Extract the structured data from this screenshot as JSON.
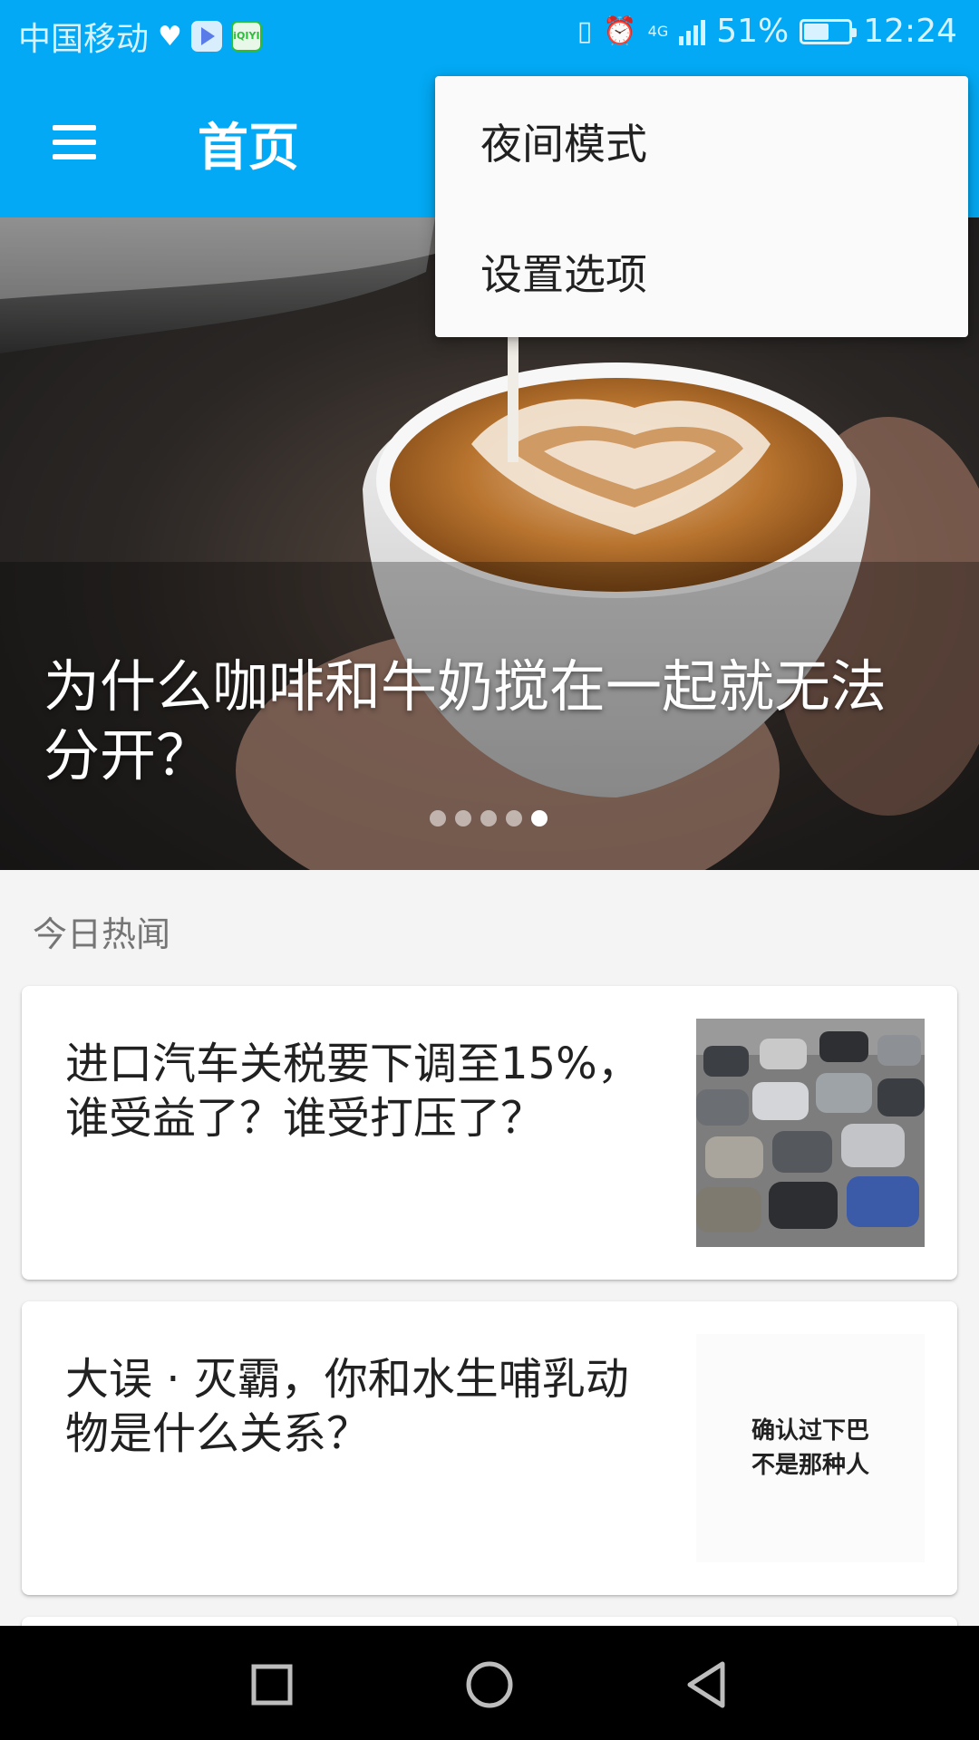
{
  "status_bar": {
    "carrier": "中国移动",
    "network": "4G",
    "battery": "51%",
    "time": "12:24",
    "background_color": "#03a9f4",
    "icons": [
      "heart-icon",
      "video-app-icon",
      "iqiyi-icon",
      "vibrate-icon",
      "alarm-icon",
      "signal-icon",
      "battery-icon"
    ]
  },
  "toolbar": {
    "title": "首页",
    "menu_icon": "hamburger-menu-icon",
    "color": "#03a9f4"
  },
  "overflow_menu": {
    "items": [
      {
        "label": "夜间模式"
      },
      {
        "label": "设置选项"
      }
    ]
  },
  "hero": {
    "title": "为什么咖啡和牛奶搅在一起就无法分开？",
    "page_count": 5,
    "active_index": 4
  },
  "feed": {
    "section_header": "今日热闻",
    "stories": [
      {
        "title": "进口汽车关税要下调至15%，谁受益了？谁受打压了？",
        "thumb": "cars-parking-lot-image"
      },
      {
        "title": "大误 · 灭霸，你和水生哺乳动物是什么关系？",
        "thumb_text": "确认过下巴\n不是那种人"
      }
    ]
  },
  "nav_bar": {
    "icons": [
      "recent-apps-icon",
      "home-icon",
      "back-icon"
    ]
  }
}
